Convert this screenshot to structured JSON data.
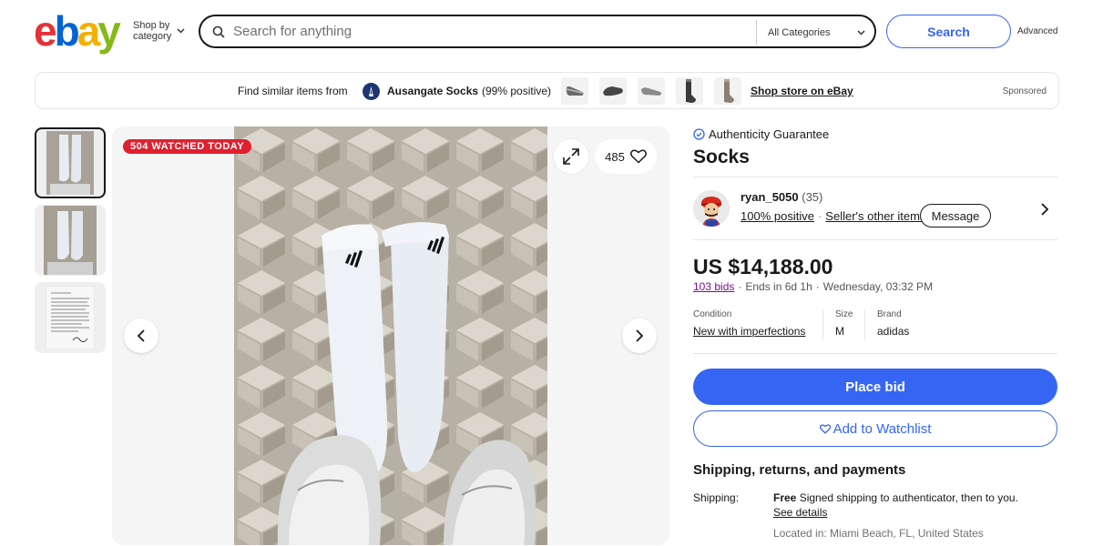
{
  "header": {
    "logo": {
      "e": "e",
      "b": "b",
      "a": "a",
      "y": "y"
    },
    "logo_colors": {
      "e": "#e53238",
      "b": "#0064d2",
      "a": "#f5af02",
      "y": "#86b817"
    },
    "shop_by_line1": "Shop by",
    "shop_by_line2": "category",
    "search_placeholder": "Search for anything",
    "category_select": "All Categories",
    "search_button": "Search",
    "advanced": "Advanced"
  },
  "store_banner": {
    "find_text": "Find similar items from",
    "store_name": "Ausangate Socks",
    "store_positive": "(99% positive)",
    "shop_store": "Shop store on eBay",
    "sponsored": "Sponsored"
  },
  "gallery": {
    "watched_badge": "504 WATCHED TODAY",
    "watch_count": "485"
  },
  "listing": {
    "authenticity": "Authenticity Guarantee",
    "title": "Socks",
    "seller": {
      "name": "ryan_5050",
      "count": "(35)",
      "positive": "100% positive",
      "other_items": "Seller's other items",
      "message": "Message"
    },
    "price": "US $14,188.00",
    "bids": "103 bids",
    "ends": "Ends in 6d 1h",
    "end_time": "Wednesday, 03:32 PM",
    "specs": {
      "condition_label": "Condition",
      "condition_value": "New with imperfections",
      "size_label": "Size",
      "size_value": "M",
      "brand_label": "Brand",
      "brand_value": "adidas"
    },
    "place_bid": "Place bid",
    "add_watchlist": "Add to Watchlist",
    "shipping": {
      "heading": "Shipping, returns, and payments",
      "label": "Shipping:",
      "free": "Free",
      "detail": "Signed shipping to authenticator, then to you.",
      "see_details": "See details",
      "located": "Located in: Miami Beach, FL, United States"
    }
  },
  "colors": {
    "primary": "#3665f3",
    "badge_red": "#e0202f",
    "bids_link": "#7b0e8c"
  }
}
